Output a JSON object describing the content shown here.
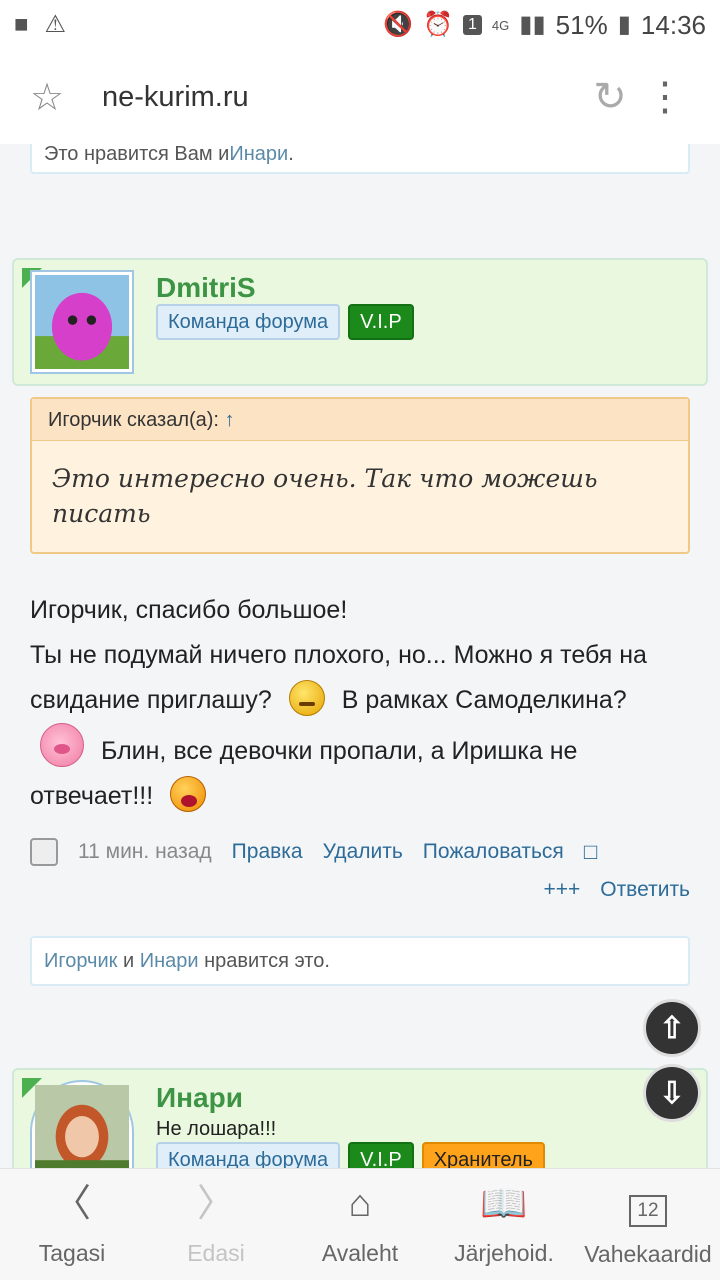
{
  "status_bar": {
    "battery_percent": "51%",
    "time": "14:36",
    "sim_number": "1",
    "network": "4G"
  },
  "address_bar": {
    "url": "ne-kurim.ru"
  },
  "likes_top": {
    "prefix": "Это нравится Вам и ",
    "user": "Инари",
    "suffix": "."
  },
  "post1": {
    "username": "DmitriS",
    "badge_team": "Команда форума",
    "badge_vip": "V.I.P",
    "quote_author": "Игорчик сказал(а):",
    "quote_arrow": "↑",
    "quote_text": "Это интересно очень. Так что можешь писать",
    "message": {
      "line1": "Игорчик, спасибо большое!",
      "line2a": "Ты не подумай ничего плохого, но... Можно я тебя на свидание приглашу?",
      "line2b": "В рамках Самоделкина?",
      "line2c": "Блин, все девочки пропали, а Иришка не отвечает!!!"
    },
    "time": "11 мин. назад",
    "action_edit": "Правка",
    "action_delete": "Удалить",
    "action_report": "Пожаловаться",
    "action_plus": "+++",
    "action_reply": "Ответить"
  },
  "likes_post1": {
    "user1": "Игорчик",
    "and": " и ",
    "user2": "Инари",
    "suffix": " нравится это."
  },
  "post2": {
    "username": "Инари",
    "status": "Не лошара!!!",
    "badge_team": "Команда форума",
    "badge_vip": "V.I.P",
    "badge_keeper": "Хранитель"
  },
  "bottom_nav": {
    "back": "Tagasi",
    "forward": "Edasi",
    "home": "Avaleht",
    "bookmarks": "Järjehoid.",
    "tabs": "Vahekaardid",
    "tab_count": "12"
  },
  "colors": {
    "post_head_bg": "#e9f8df",
    "username": "#3c9444",
    "link": "#2d6b98",
    "vip": "#1b8a1b",
    "keeper": "#ffa31a"
  }
}
